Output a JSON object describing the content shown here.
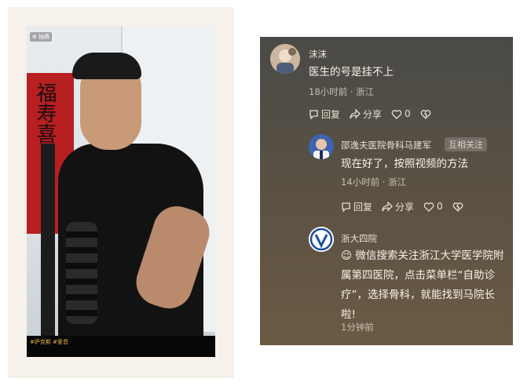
{
  "video": {
    "corner_tag": "⊕ 抽赛",
    "poster_text": "福寿喜",
    "hashtags": "#萨克斯  #爱音"
  },
  "comments": [
    {
      "name": "沫沫",
      "text": "医生的号是挂不上",
      "meta": "18小时前 · 浙江",
      "reply_label": "回复",
      "share_label": "分享",
      "like_count": "0"
    },
    {
      "name": "邵逸夫医院骨科马建军",
      "badge": "互相关注",
      "text": "现在好了，按照视频的方法",
      "meta": "14小时前 · 浙江",
      "reply_label": "回复",
      "share_label": "分享",
      "like_count": "0"
    },
    {
      "name": "浙大四院",
      "emoji": "😉",
      "text_line1": "微信搜索关注浙江大学医学院附",
      "text_line2": "属第四医院，点击菜单栏“自助诊",
      "text_line3": "疗”，选择骨科，就能找到马院长",
      "text_line4": "啦!",
      "meta": "1分钟前"
    }
  ],
  "colors": {
    "panel_top": "#4a4a46",
    "panel_bottom": "#6b5a44",
    "hashtag": "#e3b53a",
    "poster": "#b71f21"
  }
}
